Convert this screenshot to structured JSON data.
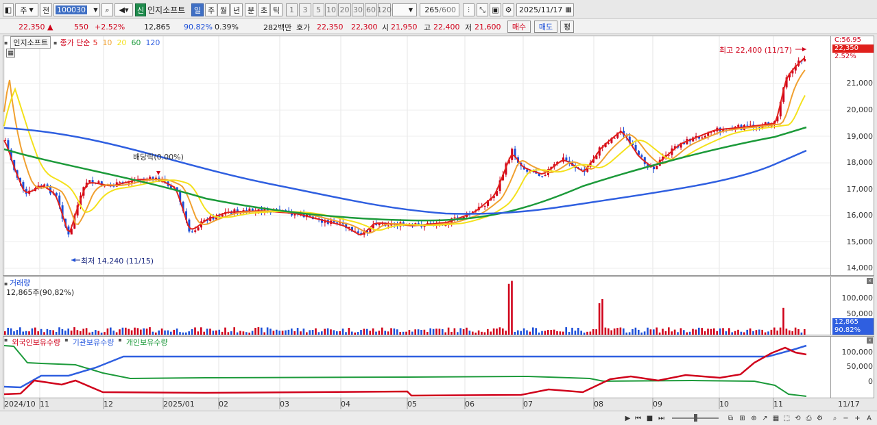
{
  "toolbar": {
    "market_label": "주",
    "prev_label": "전",
    "code_value": "100030",
    "new_badge": "신",
    "stock_name": "인지소프트",
    "periods": [
      "일",
      "주",
      "월",
      "년",
      "분",
      "초",
      "틱"
    ],
    "selected_period": "일",
    "intervals": [
      "1",
      "3",
      "5",
      "10",
      "20",
      "30",
      "60",
      "120"
    ],
    "count_value": "265",
    "count_total": "/600",
    "date_value": "2025/11/17"
  },
  "quote": {
    "price": "22,350",
    "arrow": "▲",
    "change": "550",
    "change_pct": "+2.52%",
    "volume": "12,865",
    "volume_ratio": "90.82%",
    "turnover": "0.39%",
    "amount": "282백만",
    "hoga_label": "호가",
    "ask": "22,350",
    "bid": "22,300",
    "open_label": "시",
    "open": "21,950",
    "high_label": "고",
    "high": "22,400",
    "low_label": "저",
    "low": "21,600",
    "buy_button": "매수",
    "sell_button": "매도",
    "avg_button": "평"
  },
  "price_pane": {
    "stock_tag": "인지소프트",
    "legend_prefix": "종가 단순",
    "ma_labels": [
      "5",
      "10",
      "20",
      "60",
      "120"
    ],
    "ma_colors": [
      "#e0201c",
      "#f0a030",
      "#f4e11c",
      "#1c9a3a",
      "#2f5fe0"
    ],
    "high_annotation": "최고 22,400 (11/17)",
    "low_annotation": "최저 14,240 (11/15)",
    "dividend_annotation": "배당락(0.00%)",
    "axis_top_label": "C:56.95",
    "last_price_tag": "22,350",
    "last_pct_tag": "2.52%",
    "y_ticks": [
      "21,000",
      "20,000",
      "19,000",
      "18,000",
      "17,000",
      "16,000",
      "15,000",
      "14,000"
    ]
  },
  "volume_pane": {
    "title": "거래량",
    "value_label": "12,865주(90,82%)",
    "y_ticks": [
      "100,000",
      "50,000"
    ],
    "last_tag": "12,865",
    "last_pct_tag": "90.82%"
  },
  "holder_pane": {
    "legend": [
      "외국인보유수량",
      "기관보유수량",
      "개인보유수량"
    ],
    "y_ticks": [
      "100,000",
      "50,000",
      "0"
    ]
  },
  "x_axis": {
    "labels": [
      "2024/10",
      "11",
      "12",
      "2025/01",
      "02",
      "03",
      "04",
      "05",
      "06",
      "07",
      "08",
      "09",
      "10",
      "11"
    ],
    "end_label": "11/17"
  },
  "colors": {
    "up": "#d0021b",
    "down": "#1d4fd8",
    "selected": "#3f6fc4"
  }
}
